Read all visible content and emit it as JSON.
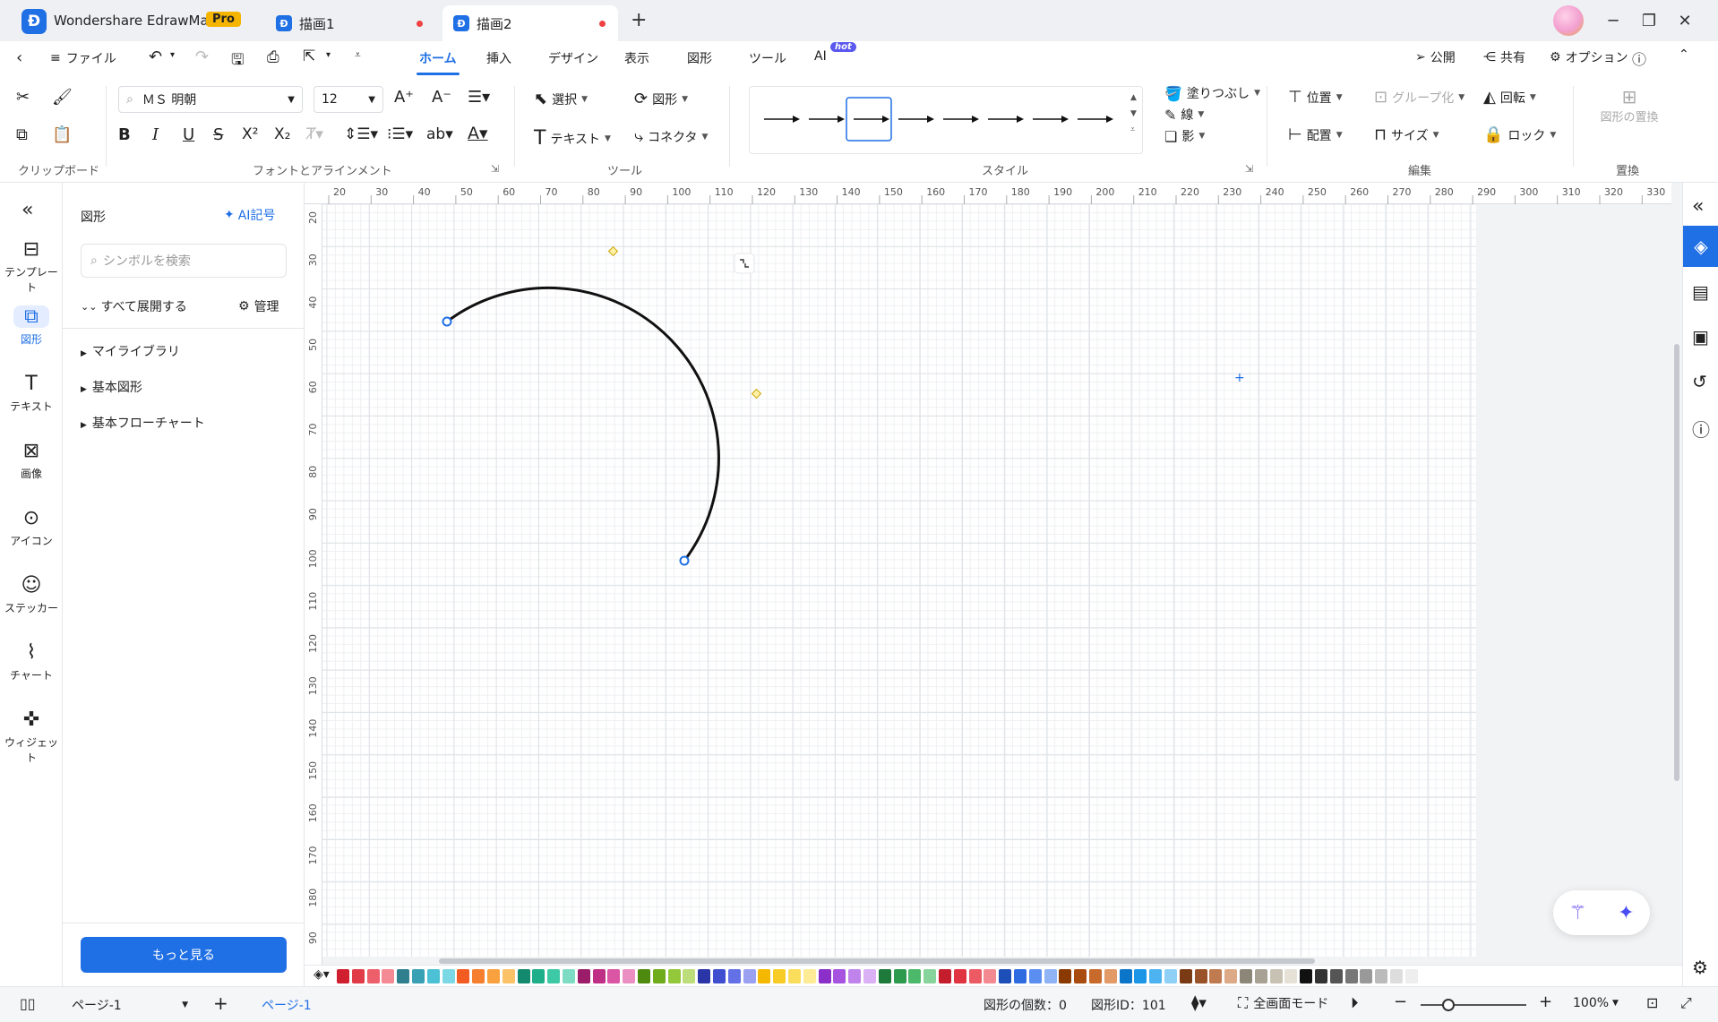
{
  "app": {
    "name": "Wondershare EdrawMax",
    "pro_badge": "Pro",
    "brand_color": "#1f6fe5"
  },
  "tabs": [
    {
      "label": "描画1",
      "unsaved": true
    },
    {
      "label": "描画2",
      "unsaved": true,
      "active": true
    }
  ],
  "menubar": {
    "file": "ファイル",
    "tabs": [
      "ホーム",
      "挿入",
      "デザイン",
      "表示",
      "図形",
      "ツール",
      "AI"
    ],
    "active_tab": "ホーム",
    "ai_badge": "hot",
    "publish": "公開",
    "share": "共有",
    "options": "オプション"
  },
  "ribbon": {
    "font_name": "ＭＳ 明朝",
    "font_size": "12",
    "groups": {
      "clipboard": "クリップボード",
      "font": "フォントとアラインメント",
      "tools": "ツール",
      "style": "スタイル",
      "edit": "編集",
      "replace": "置換"
    },
    "tools": {
      "select": "選択",
      "shape": "図形",
      "text": "テキスト",
      "connector": "コネクタ"
    },
    "style": {
      "fill": "塗りつぶし",
      "line": "線",
      "shadow": "影"
    },
    "edit": {
      "position": "位置",
      "group": "グループ化",
      "rotate": "回転",
      "align": "配置",
      "size": "サイズ",
      "lock": "ロック"
    },
    "replace_shape": "図形の置換"
  },
  "leftrail": [
    {
      "label": "テンプレート",
      "icon": "template-icon"
    },
    {
      "label": "図形",
      "icon": "shapes-icon",
      "active": true
    },
    {
      "label": "テキスト",
      "icon": "text-icon"
    },
    {
      "label": "画像",
      "icon": "image-icon"
    },
    {
      "label": "アイコン",
      "icon": "icon-icon"
    },
    {
      "label": "ステッカー",
      "icon": "sticker-icon"
    },
    {
      "label": "チャート",
      "icon": "chart-icon"
    },
    {
      "label": "ウィジェット",
      "icon": "widget-icon"
    }
  ],
  "panel": {
    "title": "図形",
    "ai_symbol": "AI記号",
    "search_placeholder": "シンボルを検索",
    "expand_all": "すべて展開する",
    "manage": "管理",
    "libraries": [
      "マイライブラリ",
      "基本図形",
      "基本フローチャート"
    ],
    "more": "もっと見る"
  },
  "ruler": {
    "h_ticks": [
      "20",
      "30",
      "40",
      "50",
      "60",
      "70",
      "80",
      "90",
      "100",
      "110",
      "120",
      "130",
      "140",
      "150",
      "160",
      "170",
      "180",
      "190",
      "200",
      "210",
      "220",
      "230",
      "240",
      "250",
      "260",
      "270",
      "280",
      "290",
      "300",
      "310",
      "320",
      "330"
    ],
    "v_ticks": [
      "20",
      "30",
      "40",
      "50",
      "60",
      "70",
      "80",
      "90",
      "100",
      "110",
      "120",
      "130",
      "140",
      "150",
      "160",
      "170",
      "180",
      "90"
    ]
  },
  "statusbar": {
    "page_selector": "ページ-1",
    "page_tab": "ページ-1",
    "shape_count_label": "図形の個数：",
    "shape_count": "0",
    "shape_id_label": "図形ID：",
    "shape_id": "101",
    "fullscreen": "全画面モード",
    "zoom": "100%"
  },
  "palette": [
    "#d01f2e",
    "#e23b48",
    "#ec5f6b",
    "#f48b94",
    "#2f7f8f",
    "#3aa0b4",
    "#4cc0d4",
    "#7dd8e6",
    "#f25c22",
    "#f57f2f",
    "#f9a13e",
    "#fbc267",
    "#138a6e",
    "#1fae8a",
    "#3dc9a5",
    "#7fdcc4",
    "#9b1d6a",
    "#c02f86",
    "#da55a3",
    "#eb8fc3",
    "#4f8a10",
    "#6fab1a",
    "#93c83a",
    "#bddc7a",
    "#2a35a8",
    "#3f4fd0",
    "#6470e6",
    "#9aa1f0",
    "#f5b800",
    "#f8cc27",
    "#fbdd5c",
    "#fdeb96",
    "#8a2fc8",
    "#a653e0",
    "#c083ec",
    "#d9b1f4",
    "#1e7a3a",
    "#2e9a4e",
    "#4cb96a",
    "#86d49c",
    "#c41e2c",
    "#e03440",
    "#ec5a64",
    "#f48a91",
    "#1d4fb8",
    "#2f6be0",
    "#5a8ef0",
    "#90b3f6",
    "#8a3a00",
    "#a84c10",
    "#c86a2c",
    "#e29a66",
    "#0b75c9",
    "#1c95e6",
    "#4db2f0",
    "#8fd0f6",
    "#7a3a14",
    "#9a5228",
    "#c07a50",
    "#dcaa86",
    "#8c8678",
    "#a8a294",
    "#c8c2b4",
    "#e6e1d6",
    "#111111",
    "#333333",
    "#555555",
    "#777777",
    "#999999",
    "#bbbbbb",
    "#dddddd",
    "#eeeeee"
  ]
}
